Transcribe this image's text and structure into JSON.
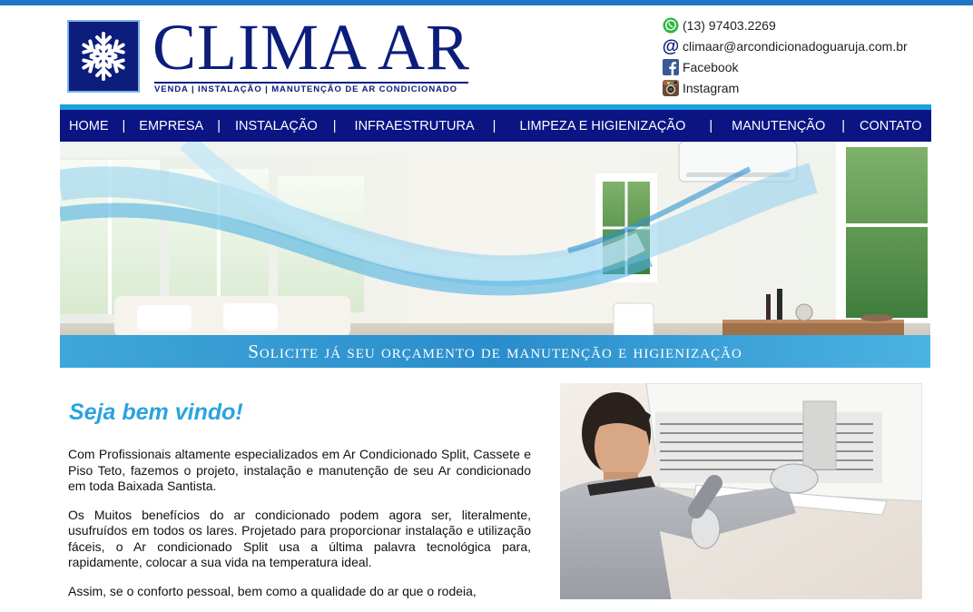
{
  "logo": {
    "title": "CLIMA AR",
    "tagline": "VENDA | INSTALAÇÃO | MANUTENÇÃO DE AR CONDICIONADO"
  },
  "contacts": {
    "phone": "(13) 97403.2269",
    "email": "climaar@arcondicionadoguaruja.com.br",
    "facebook": "Facebook",
    "instagram": "Instagram"
  },
  "nav": {
    "separator": "|",
    "items": [
      {
        "label": "HOME"
      },
      {
        "label": "EMPRESA"
      },
      {
        "label": "INSTALAÇÃO"
      },
      {
        "label": "INFRAESTRUTURA"
      },
      {
        "label": "LIMPEZA E HIGIENIZAÇÃO"
      },
      {
        "label": "MANUTENÇÃO"
      },
      {
        "label": "CONTATO"
      }
    ]
  },
  "hero": {
    "caption": "Solicite já seu orçamento de manutenção e higienização"
  },
  "content": {
    "heading": "Seja bem vindo!",
    "paragraphs": [
      "Com Profissionais altamente especializados em Ar Condicionado Split, Cassete e Piso Teto, fazemos o projeto, instalação e manutenção de seu Ar condicionado em toda Baixada Santista.",
      "Os Muitos benefícios do ar condicionado podem agora ser, literalmente, usufruídos em todos os lares. Projetado para proporcionar instalação e utilização fáceis, o Ar condicionado Split usa a última palavra tecnológica para, rapidamente, colocar a sua vida na temperatura ideal.",
      "Assim, se o conforto pessoal, bem como a qualidade do ar que o rodeia,"
    ]
  },
  "colors": {
    "brand_navy": "#0c1d7c",
    "nav_bg": "#0a1483",
    "accent_blue": "#1aa0e0",
    "heading_blue": "#2aa3de",
    "top_bar": "#1f76c4"
  },
  "icons": {
    "logo": "snowflake-icon",
    "phone": "whatsapp-icon",
    "email": "at-sign-icon",
    "facebook": "facebook-icon",
    "instagram": "instagram-icon"
  }
}
